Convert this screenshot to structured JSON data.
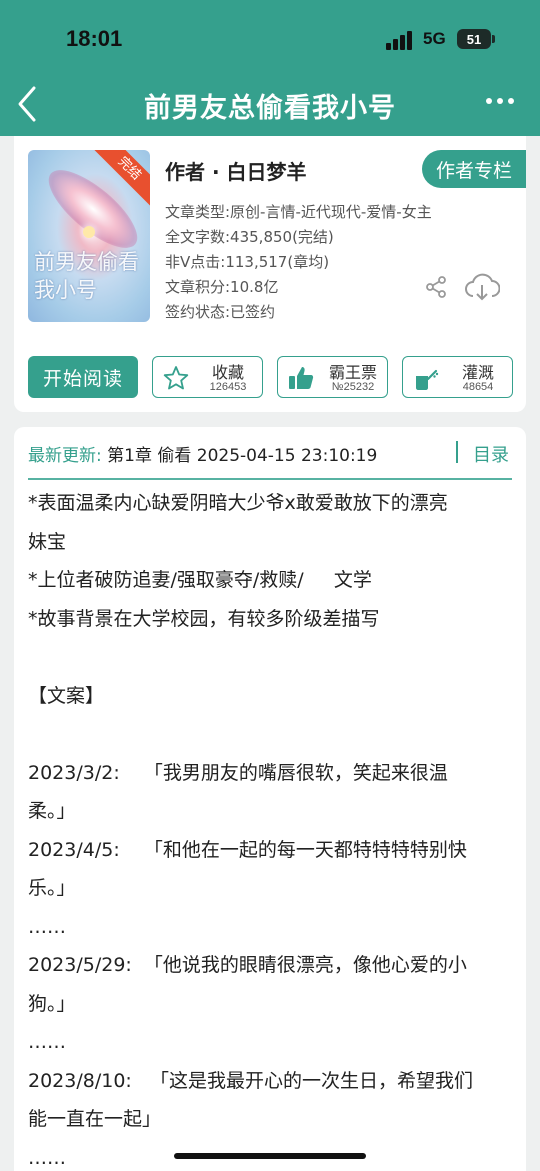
{
  "status_bar": {
    "time": "18:01",
    "network": "5G",
    "battery": "51"
  },
  "nav": {
    "title": "前男友总偷看我小号",
    "back_icon": "chevron-left-icon",
    "more_icon": "more-dots-icon"
  },
  "book": {
    "cover_title": "前男友偷看我小号",
    "cover_badge": "完结",
    "author_line": "作者 · 白日梦羊",
    "author_column_label": "作者专栏",
    "info": [
      "文章类型:原创-言情-近代现代-爱情-女主",
      "全文字数:435,850(完结)",
      "非V点击:113,517(章均)",
      "文章积分:10.8亿",
      "签约状态:已签约"
    ]
  },
  "actions": {
    "start_reading": "开始阅读",
    "favorite": {
      "label": "收藏",
      "count": "126453"
    },
    "ticket": {
      "label": "霸王票",
      "count": "№25232"
    },
    "nutrition": {
      "label": "灌溉",
      "count": "48654"
    }
  },
  "update": {
    "label": "最新更新:",
    "chapter": "第1章 偷看 2025-04-15 23:10:19",
    "toc_label": "目录"
  },
  "description": [
    "*表面温柔内心缺爱阴暗大少爷x敢爱敢放下的漂亮",
    "妹宝",
    "*上位者破防追妻/强取豪夺/救赎/     文学",
    "*故事背景在大学校园，有较多阶级差描写",
    "",
    "【文案】",
    "",
    "2023/3/2:    「我男朋友的嘴唇很软，笑起来很温",
    "柔。」",
    "2023/4/5:    「和他在一起的每一天都特特特特别快",
    "乐。」",
    "……",
    "2023/5/29:  「他说我的眼睛很漂亮，像他心爱的小",
    "狗。」",
    "……",
    "2023/8/10:   「这是我最开心的一次生日，希望我们",
    "能一直在一起」",
    "……"
  ],
  "colors": {
    "accent": "#35a08d",
    "ribbon": "#e8502f"
  }
}
